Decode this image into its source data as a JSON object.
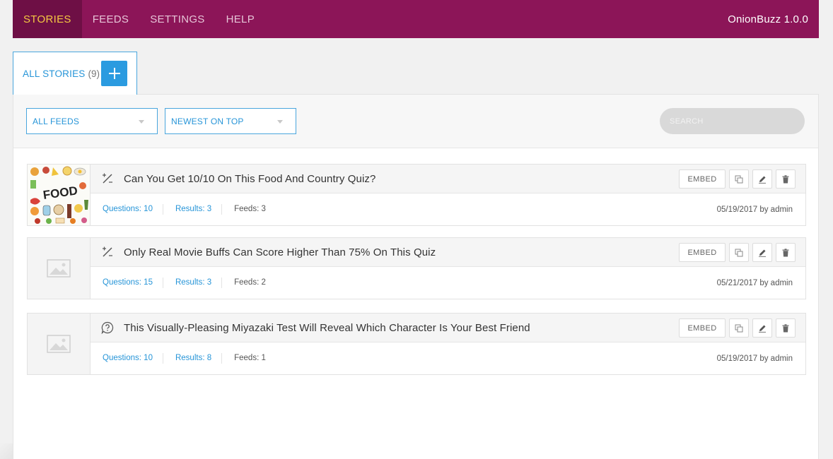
{
  "nav": {
    "items": [
      {
        "label": "STORIES",
        "active": true
      },
      {
        "label": "FEEDS",
        "active": false
      },
      {
        "label": "SETTINGS",
        "active": false
      },
      {
        "label": "HELP",
        "active": false
      }
    ],
    "brand": "OnionBuzz 1.0.0"
  },
  "tab": {
    "label": "ALL STORIES",
    "count": "(9)",
    "add_icon": "plus-icon"
  },
  "filters": {
    "feed_select": "ALL FEEDS",
    "sort_select": "NEWEST ON TOP",
    "search_placeholder": "SEARCH"
  },
  "colors": {
    "brand_bar": "#8c1558",
    "active_nav": "#6e0f45",
    "active_text": "#f5c842",
    "accent": "#2b9be0"
  },
  "stories": [
    {
      "title": "Can You Get 10/10 On This Food And Country Quiz?",
      "type_icon": "percent-icon",
      "thumb": "food-image",
      "questions": "Questions: 10",
      "results": "Results: 3",
      "feeds": "Feeds: 3",
      "date": "05/19/2017 by admin",
      "embed": "EMBED"
    },
    {
      "title": "Only Real Movie Buffs Can Score Higher Than 75% On This Quiz",
      "type_icon": "percent-icon",
      "thumb": "image-placeholder",
      "questions": "Questions: 15",
      "results": "Results: 3",
      "feeds": "Feeds: 2",
      "date": "05/21/2017 by admin",
      "embed": "EMBED"
    },
    {
      "title": "This Visually-Pleasing Miyazaki Test Will Reveal Which Character Is Your Best Friend",
      "type_icon": "question-bubble-icon",
      "thumb": "image-placeholder",
      "questions": "Questions: 10",
      "results": "Results: 8",
      "feeds": "Feeds: 1",
      "date": "05/19/2017 by admin",
      "embed": "EMBED"
    }
  ]
}
